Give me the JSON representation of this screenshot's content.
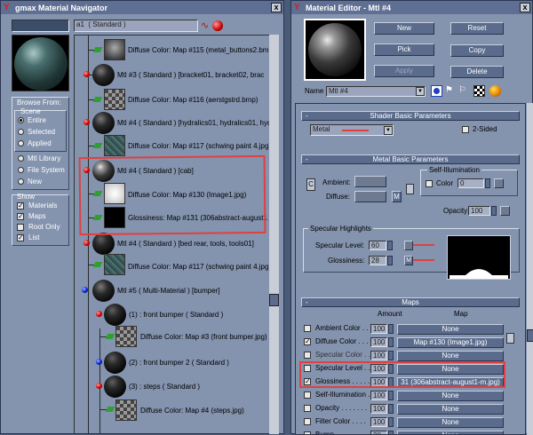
{
  "navigator": {
    "title": "gmax Material Navigator",
    "close": "x",
    "current_name": "a1",
    "current_type": "( Standard )",
    "browse_from": {
      "label": "Browse From:",
      "scene_label": "Scene",
      "options": [
        {
          "label": "Entire",
          "selected": true
        },
        {
          "label": "Selected",
          "selected": false
        },
        {
          "label": "Applied",
          "selected": false
        }
      ],
      "extra_options": [
        {
          "label": "Mtl Library",
          "selected": false
        },
        {
          "label": "File System",
          "selected": false
        },
        {
          "label": "New",
          "selected": false
        }
      ]
    },
    "show": {
      "label": "Show",
      "items": [
        {
          "label": "Materials",
          "checked": true
        },
        {
          "label": "Maps",
          "checked": true
        },
        {
          "label": "Root Only",
          "checked": false
        },
        {
          "label": "List",
          "checked": true
        }
      ]
    },
    "tree": [
      {
        "kind": "map",
        "label": "Diffuse Color: Map #115 (metal_buttons2.bmp"
      },
      {
        "kind": "mtl",
        "label": "Mtl #3  ( Standard )  [bracket01, bracket02, brac"
      },
      {
        "kind": "map",
        "label": "Diffuse Color: Map #116 (aerstgstrd.bmp)"
      },
      {
        "kind": "mtl",
        "label": "Mtl #4  ( Standard )  [hydralics01, hydralics01, hydr"
      },
      {
        "kind": "map",
        "label": "Diffuse Color: Map #117 (schwing paint 4.jpg)"
      },
      {
        "kind": "mtl",
        "label": "Mtl #4  ( Standard )  [cab]"
      },
      {
        "kind": "map",
        "label": "Diffuse Color: Map #130 (Image1.jpg)"
      },
      {
        "kind": "map",
        "label": "Glossiness: Map #131 (306abstract-august1"
      },
      {
        "kind": "mtl",
        "label": "Mtl #4  ( Standard )  [bed rear, tools, tools01]"
      },
      {
        "kind": "map",
        "label": "Diffuse Color: Map #117 (schwing paint 4.jpg)"
      },
      {
        "kind": "multi",
        "label": "Mtl #5  ( Multi-Material )  [bumper]"
      },
      {
        "kind": "mtl",
        "label": "(1) : front bumper  ( Standard )"
      },
      {
        "kind": "map",
        "label": "Diffuse Color: Map #3 (front bumper.jpg)"
      },
      {
        "kind": "sub",
        "label": "(2) : front bumper 2  ( Standard )"
      },
      {
        "kind": "mtl",
        "label": "(3) : steps  ( Standard )"
      },
      {
        "kind": "map",
        "label": "Diffuse Color: Map #4 (steps.jpg)"
      }
    ]
  },
  "editor": {
    "title": "Material Editor - Mtl #4",
    "close": "x",
    "buttons": {
      "new": "New",
      "reset": "Reset",
      "pick": "Pick",
      "copy": "Copy",
      "apply": "Apply",
      "delete": "Delete"
    },
    "name_label": "Name",
    "name_value": "Mtl #4",
    "shader_rollout": {
      "title": "Shader Basic Parameters",
      "shader": "Metal",
      "two_sided": "2-Sided"
    },
    "metal_rollout": {
      "title": "Metal Basic Parameters",
      "ambient": "Ambient:",
      "diffuse": "Diffuse:",
      "lock": "M",
      "self_illum": "Self-Illumination",
      "color": "Color",
      "color_value": "0",
      "opacity": "Opacity:",
      "opacity_value": "100"
    },
    "specular": {
      "title": "Specular Highlights",
      "level_label": "Specular Level:",
      "level_value": "60",
      "gloss_label": "Glossiness:",
      "gloss_value": "28",
      "gloss_map": "M"
    },
    "maps_rollout": {
      "title": "Maps",
      "amount_header": "Amount",
      "map_header": "Map",
      "rows": [
        {
          "label": "Ambient Color . . .",
          "checked": false,
          "amount": "100",
          "map": "None",
          "dim": false
        },
        {
          "label": "Diffuse Color . . .",
          "checked": true,
          "amount": "100",
          "map": "Map #130 (Image1.jpg)",
          "dim": false
        },
        {
          "label": "Specular Color . . .",
          "checked": false,
          "amount": "100",
          "map": "None",
          "dim": true
        },
        {
          "label": "Specular Level . . .",
          "checked": false,
          "amount": "100",
          "map": "None",
          "dim": false
        },
        {
          "label": "Glossiness  . . . . .",
          "checked": true,
          "amount": "100",
          "map": "31 (306abstract-august1-m.jpg)",
          "dim": false
        },
        {
          "label": "Self-Illumination . .",
          "checked": false,
          "amount": "100",
          "map": "None",
          "dim": false
        },
        {
          "label": "Opacity . . . . . . .",
          "checked": false,
          "amount": "100",
          "map": "None",
          "dim": false
        },
        {
          "label": "Filter Color . . . .",
          "checked": false,
          "amount": "100",
          "map": "None",
          "dim": false
        },
        {
          "label": "Bump . . . . . . . .",
          "checked": false,
          "amount": "30",
          "map": "None",
          "dim": false
        }
      ]
    }
  }
}
